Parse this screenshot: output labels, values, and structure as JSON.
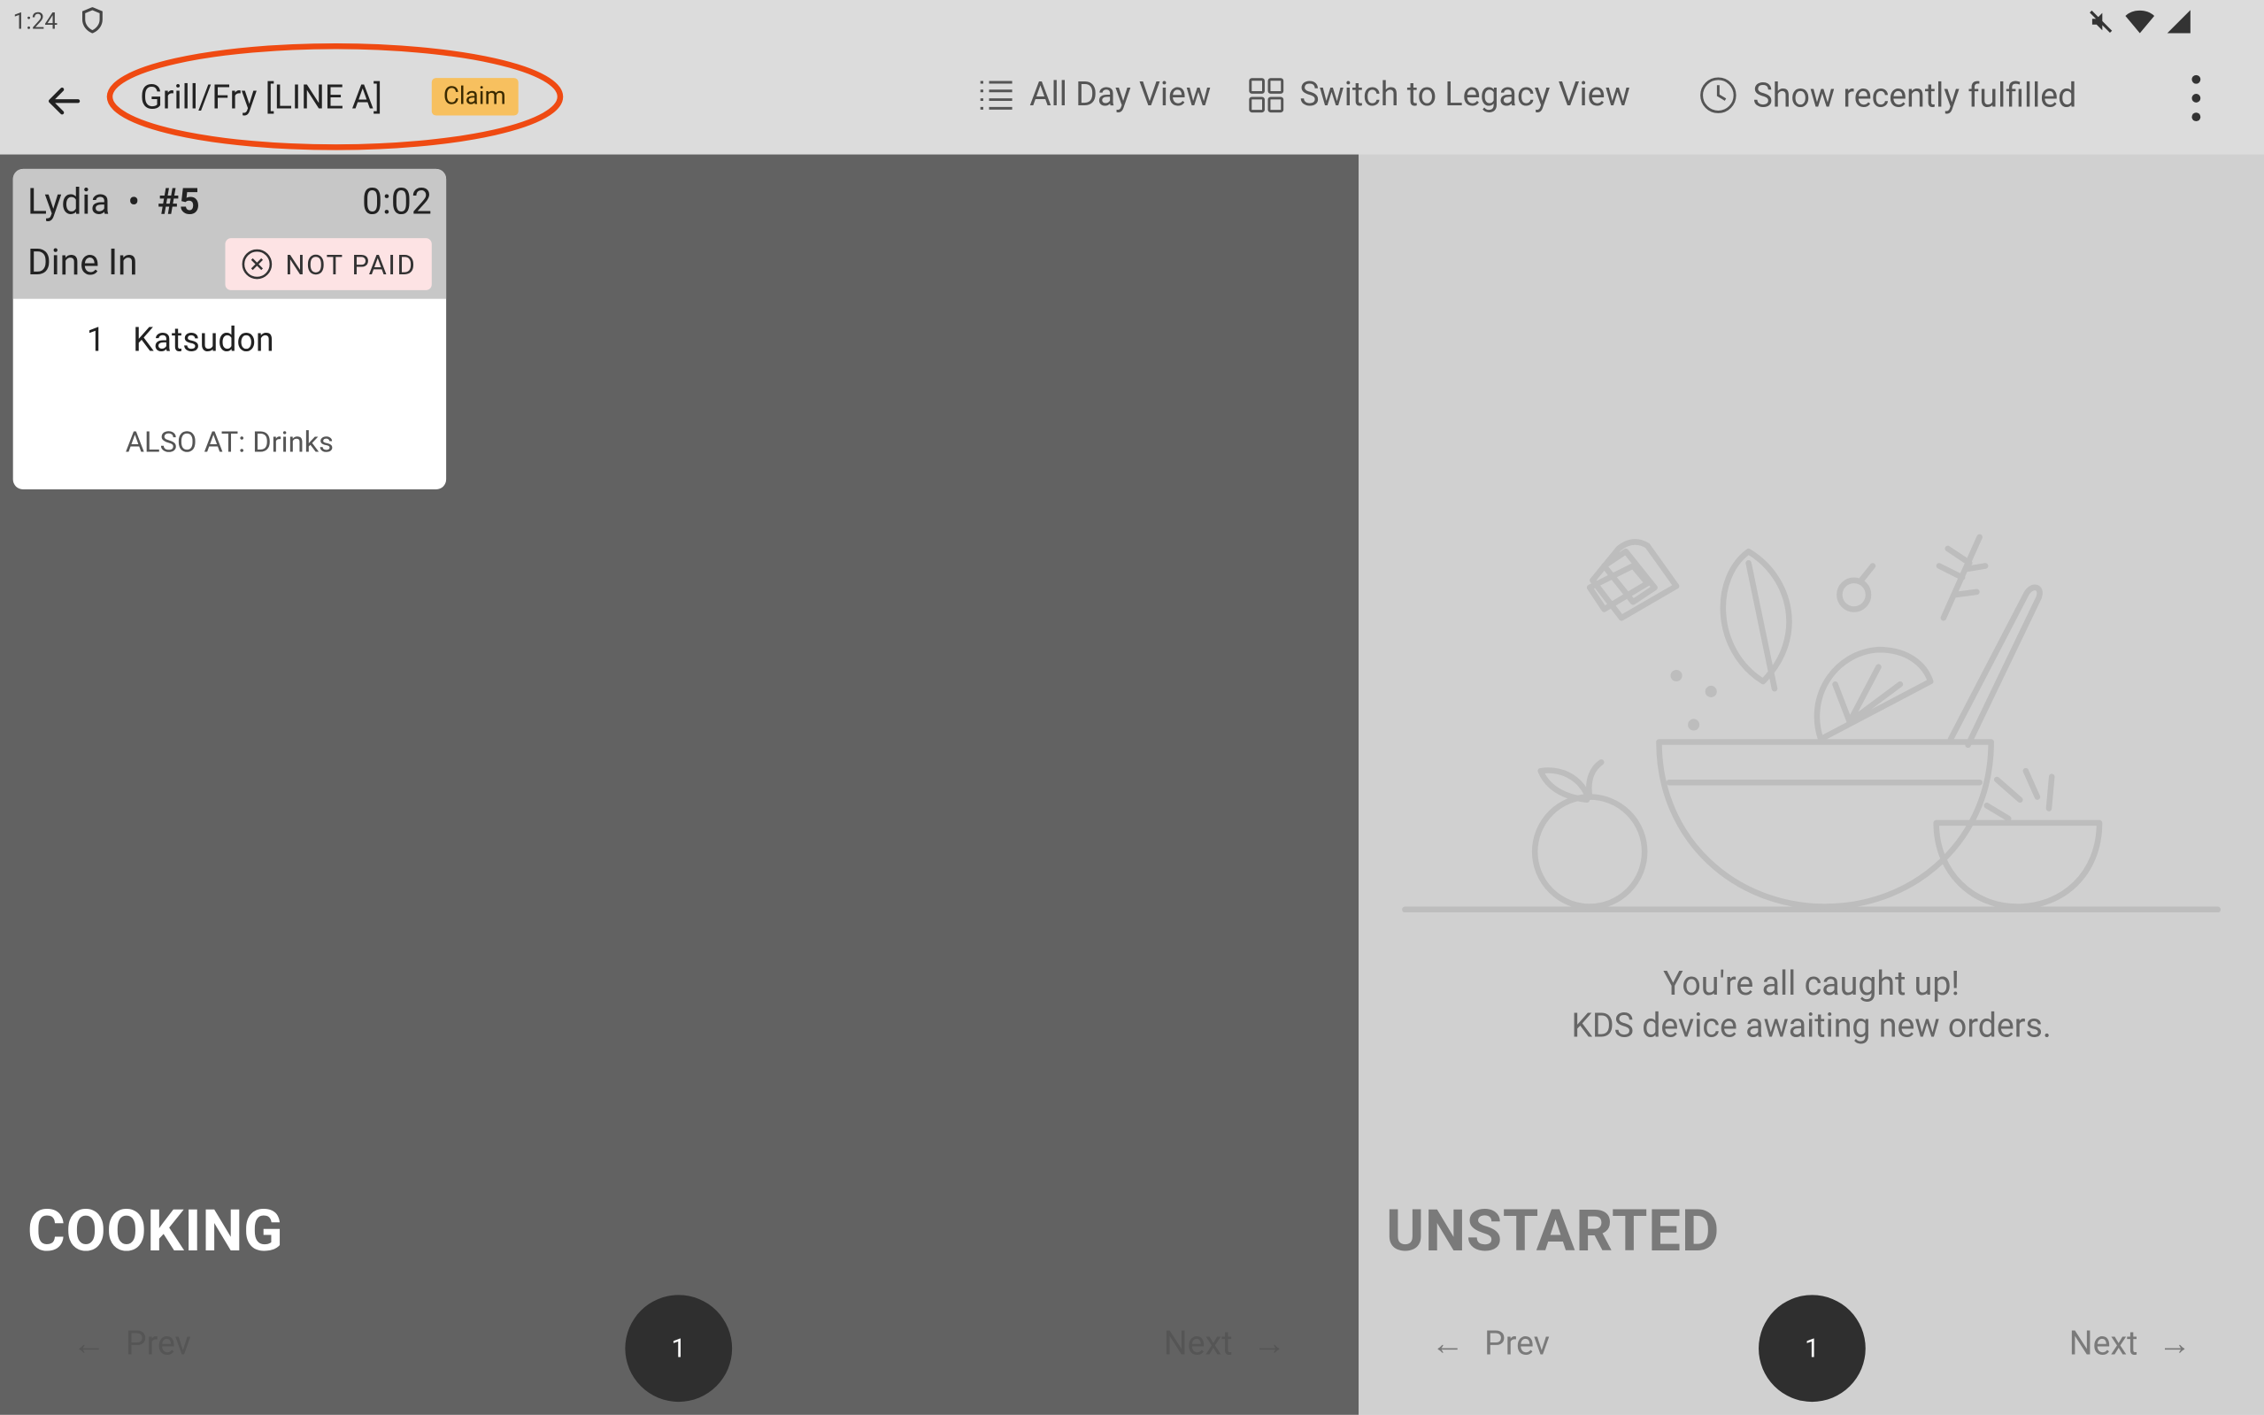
{
  "status_bar": {
    "time": "1:24"
  },
  "header": {
    "station_name": "Grill/Fry [LINE A]",
    "claim_label": "Claim",
    "all_day_view": "All Day View",
    "legacy_view": "Switch to Legacy View",
    "recently_fulfilled": "Show recently fulfilled"
  },
  "cooking": {
    "title": "COOKING",
    "ticket": {
      "customer": "Lydia",
      "separator": "•",
      "order_number": "#5",
      "elapsed": "0:02",
      "order_type": "Dine In",
      "payment_status": "NOT PAID",
      "items": [
        {
          "qty": "1",
          "name": "Katsudon"
        }
      ],
      "also_at": "ALSO AT: Drinks"
    },
    "pager": {
      "prev": "Prev",
      "page": "1",
      "next": "Next"
    }
  },
  "unstarted": {
    "title": "UNSTARTED",
    "empty_line1": "You're all caught up!",
    "empty_line2": "KDS device awaiting new orders.",
    "pager": {
      "prev": "Prev",
      "page": "1",
      "next": "Next"
    }
  },
  "colors": {
    "cooking_bg": "#626262",
    "unstarted_bg": "#d0d0d0",
    "claim_badge": "#f7c05f",
    "not_paid_bg": "#fde3e4",
    "annotation": "#ef4a12"
  }
}
